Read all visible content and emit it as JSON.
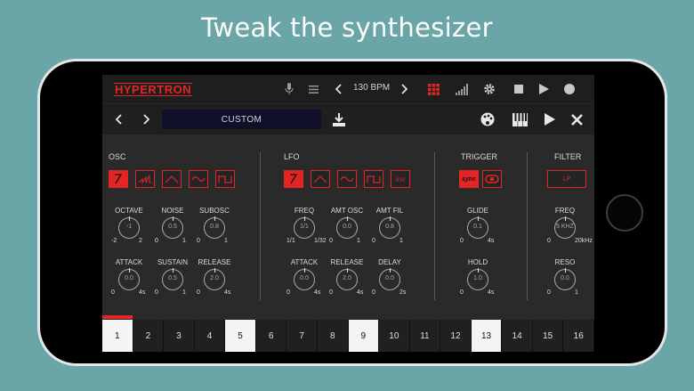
{
  "headline": "Tweak the synthesizer",
  "topbar": {
    "logo": "HYPERTRON",
    "bpm": "130 BPM"
  },
  "bar2": {
    "preset": "CUSTOM"
  },
  "osc": {
    "title": "OSC",
    "knobs": [
      {
        "label": "OCTAVE",
        "value": "-1",
        "min": "-2",
        "max": "2"
      },
      {
        "label": "NOISE",
        "value": "0.5",
        "min": "0",
        "max": "1"
      },
      {
        "label": "SUBOSC",
        "value": "0.8",
        "min": "0",
        "max": "1"
      },
      {
        "label": "ATTACK",
        "value": "0.0",
        "min": "0",
        "max": "4s"
      },
      {
        "label": "SUSTAIN",
        "value": "0.5",
        "min": "0",
        "max": "1"
      },
      {
        "label": "RELEASE",
        "value": "2.0",
        "min": "0",
        "max": "4s"
      }
    ]
  },
  "lfo": {
    "title": "LFO",
    "inv_label": "inv",
    "knobs": [
      {
        "label": "FREQ",
        "value": "1/1",
        "min": "1/1",
        "max": "1/32"
      },
      {
        "label": "AMT OSC",
        "value": "0.0",
        "min": "0",
        "max": "1"
      },
      {
        "label": "AMT FIL",
        "value": "0.8",
        "min": "0",
        "max": "1"
      },
      {
        "label": "ATTACK",
        "value": "0.0",
        "min": "0",
        "max": "4s"
      },
      {
        "label": "RELEASE",
        "value": "2.0",
        "min": "0",
        "max": "4s"
      },
      {
        "label": "DELAY",
        "value": "0.0",
        "min": "0",
        "max": "2s"
      }
    ]
  },
  "trigger": {
    "title": "TRIGGER",
    "sync_label": "sync",
    "knobs": [
      {
        "label": "GLIDE",
        "value": "0.1",
        "min": "0",
        "max": "4s"
      },
      {
        "label": "HOLD",
        "value": "1.0",
        "min": "0",
        "max": "4s"
      }
    ]
  },
  "filter": {
    "title": "FILTER",
    "lp_label": "LP",
    "knobs": [
      {
        "label": "FREQ",
        "value": "5 KHZ",
        "min": "0",
        "max": "20kHz"
      },
      {
        "label": "RESO",
        "value": "0.0",
        "min": "0",
        "max": "1"
      }
    ]
  },
  "sequencer": {
    "steps": [
      "1",
      "2",
      "3",
      "4",
      "5",
      "6",
      "7",
      "8",
      "9",
      "10",
      "11",
      "12",
      "13",
      "14",
      "15",
      "16"
    ]
  },
  "colors": {
    "accent": "#e52525",
    "background": "#6aa6a8",
    "panel": "#2a2a2a"
  }
}
